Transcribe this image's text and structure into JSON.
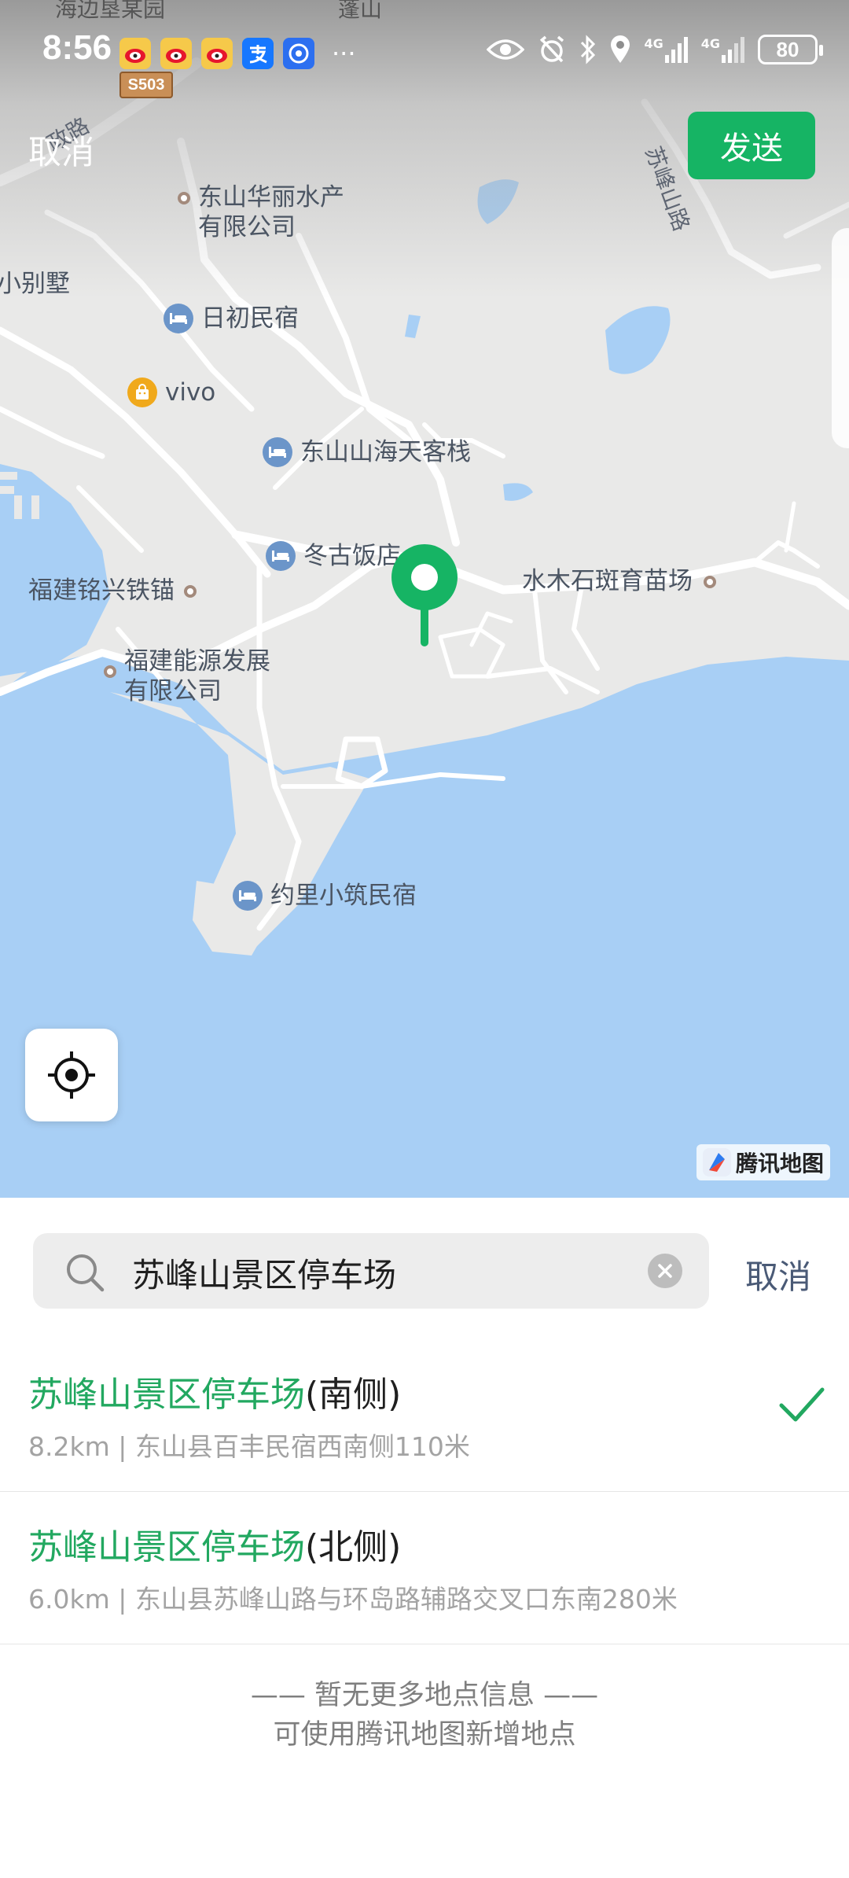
{
  "status_bar": {
    "time": "8:56",
    "more": "···",
    "battery": "80",
    "network_1": "4G",
    "network_2": "4G"
  },
  "header": {
    "cancel_label": "取消",
    "send_label": "发送"
  },
  "map": {
    "road_shield": "S503",
    "partial_top_left": "海边垦某园",
    "partial_top_mid": "蓬山",
    "road_label_1": "政路",
    "road_label_2": "苏峰山路",
    "pois": {
      "donghshan_huali": [
        "东山华丽水产",
        "有限公司"
      ],
      "villa": "小别墅",
      "richu": "日初民宿",
      "vivo": "vivo",
      "haitian": "东山山海天客栈",
      "donggu": "冬古饭店",
      "mingxing": "福建铭兴铁锚",
      "shuimu": "水木石斑育苗场",
      "nengyuan": [
        "福建能源发展",
        "有限公司"
      ],
      "yueli": "约里小筑民宿"
    },
    "logo_text": "腾讯地图",
    "colors": {
      "water": "#a8cff5",
      "land": "#e9e9e8",
      "road": "#ffffff",
      "pin": "#16b464"
    }
  },
  "search": {
    "query": "苏峰山景区停车场",
    "cancel_label": "取消"
  },
  "results": [
    {
      "highlight": "苏峰山景区停车场",
      "suffix": "(南侧)",
      "detail": "8.2km | 东山县百丰民宿西南侧110米",
      "selected": true
    },
    {
      "highlight": "苏峰山景区停车场",
      "suffix": "(北侧)",
      "detail": "6.0km | 东山县苏峰山路与环岛路辅路交叉口东南280米",
      "selected": false
    }
  ],
  "footer": {
    "line1": "—— 暂无更多地点信息 ——",
    "line2": "可使用腾讯地图新增地点"
  }
}
